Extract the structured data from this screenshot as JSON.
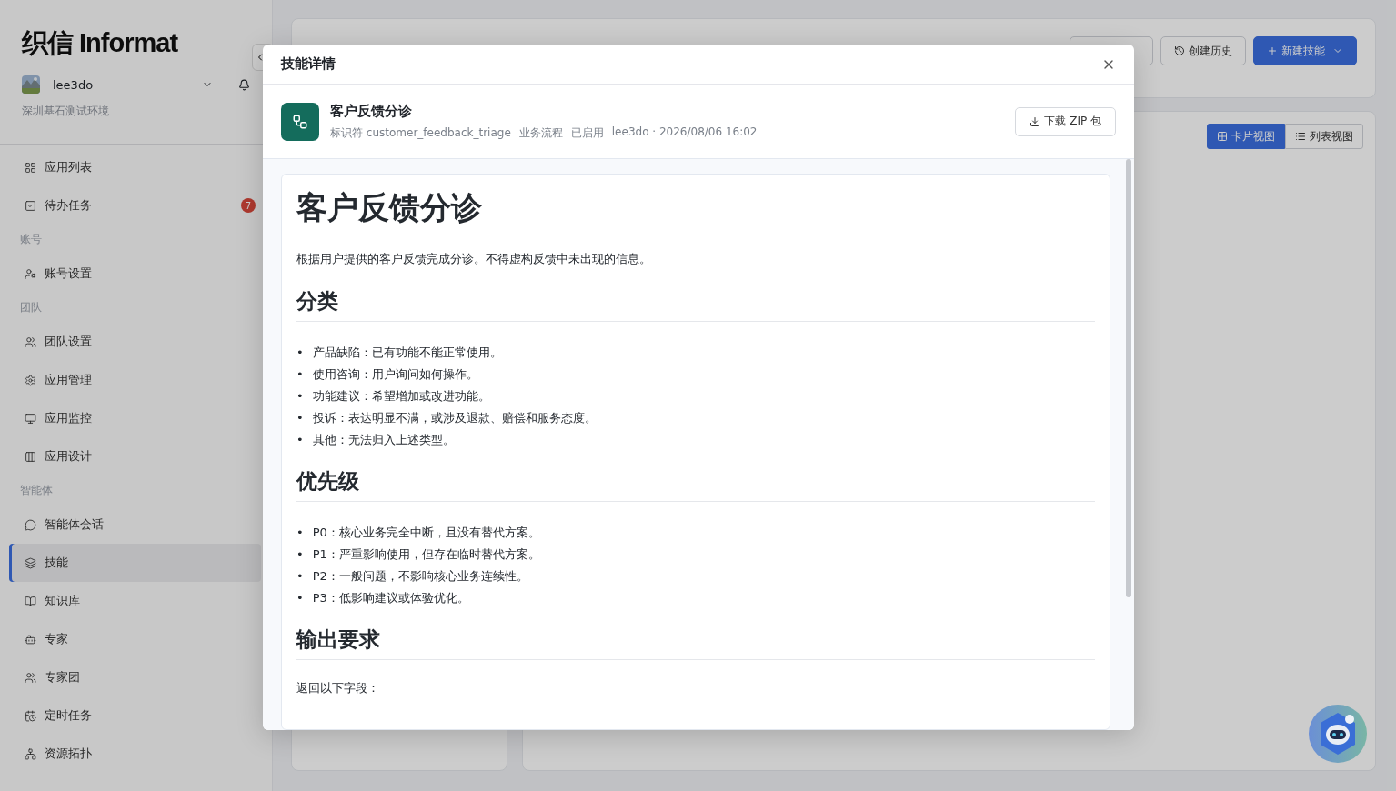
{
  "sidebar": {
    "logo": "织信 Informat",
    "user": {
      "name": "lee3do",
      "org": "深圳基石测试环境"
    },
    "nav": [
      {
        "kind": "item",
        "label": "应用列表",
        "selected": false
      },
      {
        "kind": "item",
        "label": "待办任务",
        "selected": false,
        "badge": "7"
      },
      {
        "kind": "section",
        "label": "账号"
      },
      {
        "kind": "item",
        "label": "账号设置",
        "selected": false
      },
      {
        "kind": "section",
        "label": "团队"
      },
      {
        "kind": "item",
        "label": "团队设置",
        "selected": false
      },
      {
        "kind": "item",
        "label": "应用管理",
        "selected": false
      },
      {
        "kind": "item",
        "label": "应用监控",
        "selected": false
      },
      {
        "kind": "item",
        "label": "应用设计",
        "selected": false
      },
      {
        "kind": "section",
        "label": "智能体"
      },
      {
        "kind": "item",
        "label": "智能体会话",
        "selected": false
      },
      {
        "kind": "item",
        "label": "技能",
        "selected": true
      },
      {
        "kind": "item",
        "label": "知识库",
        "selected": false
      },
      {
        "kind": "item",
        "label": "专家",
        "selected": false
      },
      {
        "kind": "item",
        "label": "专家团",
        "selected": false
      },
      {
        "kind": "item",
        "label": "定时任务",
        "selected": false
      },
      {
        "kind": "item",
        "label": "资源拓扑",
        "selected": false
      }
    ]
  },
  "page": {
    "actions": [
      "创建历史",
      "新建技能"
    ],
    "views": [
      {
        "label": "卡片视图",
        "selected": true
      },
      {
        "label": "列表视图",
        "selected": false
      }
    ]
  },
  "modal": {
    "title": "技能详情",
    "skill": {
      "name": "客户反馈分诊",
      "meta": [
        "标识符 customer_feedback_triage",
        "业务流程",
        "已启用",
        "lee3do · 2026/08/06 16:02"
      ]
    },
    "download": "下载 ZIP 包",
    "content": [
      {
        "kind": "h1",
        "text": "客户反馈分诊"
      },
      {
        "kind": "p",
        "text": "根据用户提供的客户反馈完成分诊。不得虚构反馈中未出现的信息。"
      },
      {
        "kind": "h2",
        "text": "分类"
      },
      {
        "kind": "ul",
        "marker": "•",
        "items": [
          "产品缺陷：已有功能不能正常使用。",
          "使用咨询：用户询问如何操作。",
          "功能建议：希望增加或改进功能。",
          "投诉：表达明显不满，或涉及退款、赔偿和服务态度。",
          "其他：无法归入上述类型。"
        ]
      },
      {
        "kind": "h2",
        "text": "优先级"
      },
      {
        "kind": "ul",
        "marker": "•",
        "items": [
          "P0：核心业务完全中断，且没有替代方案。",
          "P1：严重影响使用，但存在临时替代方案。",
          "P2：一般问题，不影响核心业务连续性。",
          "P3：低影响建议或体验优化。"
        ]
      },
      {
        "kind": "h2",
        "text": "输出要求"
      },
      {
        "kind": "p",
        "text": "返回以下字段："
      }
    ]
  }
}
